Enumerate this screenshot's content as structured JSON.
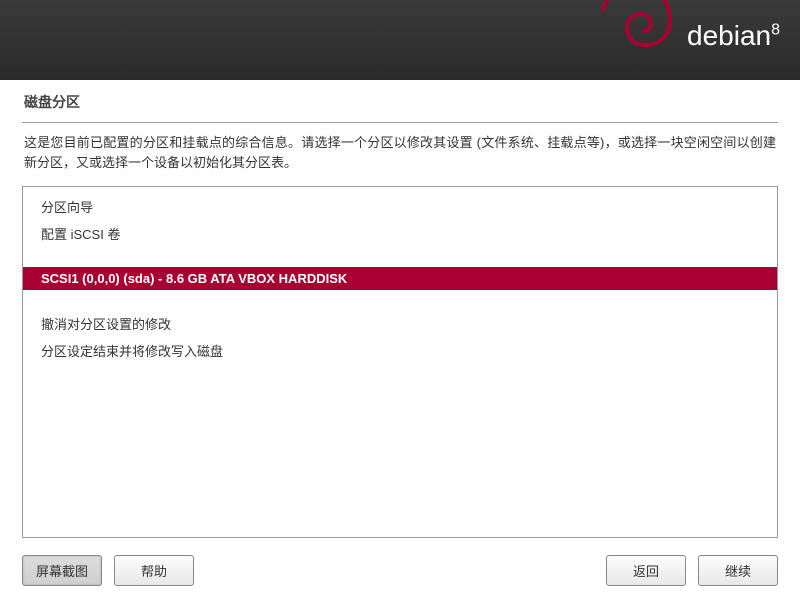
{
  "brand": {
    "name": "debian",
    "version": "8"
  },
  "page_title": "磁盘分区",
  "instructions": "这是您目前已配置的分区和挂载点的综合信息。请选择一个分区以修改其设置 (文件系统、挂载点等)，或选择一块空闲空间以创建新分区，又或选择一个设备以初始化其分区表。",
  "list": {
    "guided": "分区向导",
    "iscsi": "配置 iSCSI 卷",
    "disk": "SCSI1 (0,0,0) (sda) - 8.6 GB ATA VBOX HARDDISK",
    "undo": "撤消对分区设置的修改",
    "finish": "分区设定结束并将修改写入磁盘"
  },
  "buttons": {
    "screenshot": "屏幕截图",
    "help": "帮助",
    "back": "返回",
    "continue": "继续"
  }
}
